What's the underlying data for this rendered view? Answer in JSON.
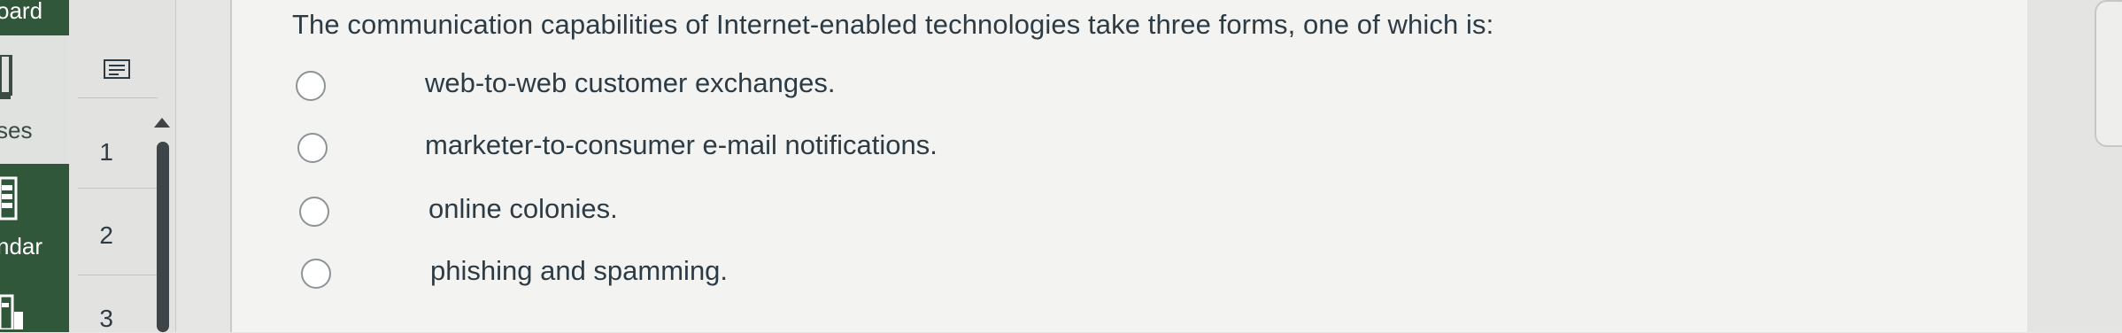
{
  "global_nav": {
    "items": [
      {
        "label": "oard",
        "icon": "dashboard-icon"
      },
      {
        "label": "ses",
        "icon": "courses-icon"
      },
      {
        "label": "ndar",
        "icon": "calendar-icon"
      },
      {
        "label": "",
        "icon": "inbox-icon"
      }
    ]
  },
  "question_nav": {
    "toolbar_icon": "question-list-icon",
    "numbers": [
      "1",
      "2",
      "3"
    ]
  },
  "question": {
    "text": "The communication capabilities of Internet-enabled technologies take three forms, one of which is:",
    "options": [
      "web-to-web customer exchanges.",
      "marketer-to-consumer e-mail notifications.",
      "online colonies.",
      "phishing and spamming."
    ]
  },
  "colors": {
    "nav_green": "#30573a",
    "text": "#2d3b45",
    "panel_bg": "#f3f4f2"
  }
}
